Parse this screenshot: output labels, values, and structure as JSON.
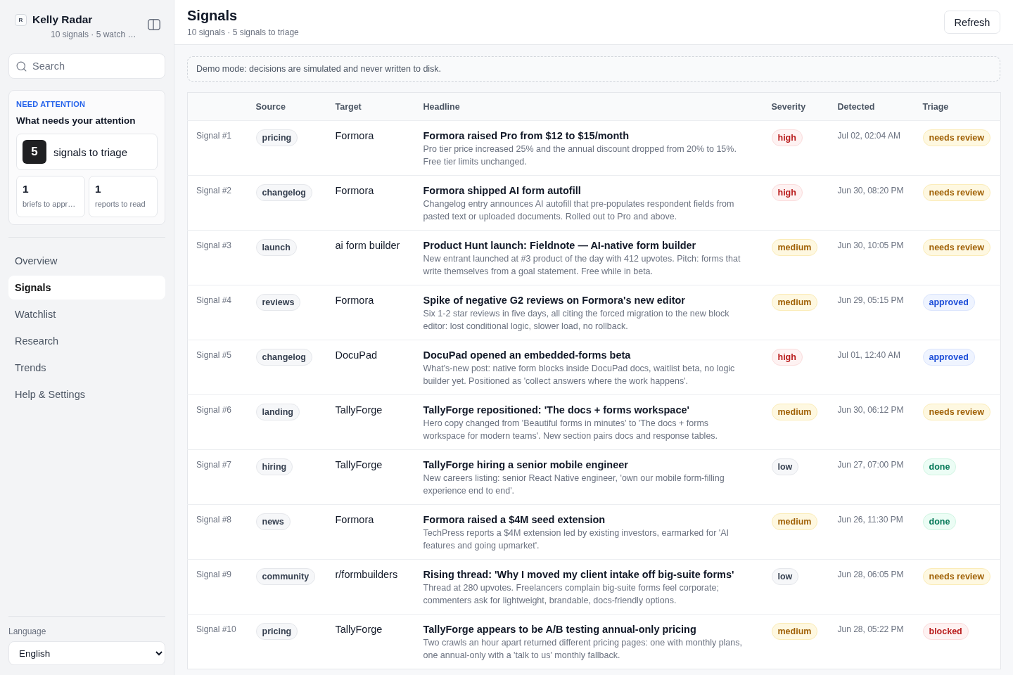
{
  "sidebar": {
    "app": {
      "logo": "R",
      "name": "Kelly Radar",
      "subtitle": "10 signals · 5 watch …"
    },
    "search": {
      "placeholder": "Search"
    },
    "attention": {
      "eyebrow": "NEED ATTENTION",
      "title": "What needs your attention",
      "primary": {
        "count": "5",
        "label": "signals to triage"
      },
      "secondary": [
        {
          "count": "1",
          "label": "briefs to appr…"
        },
        {
          "count": "1",
          "label": "reports to read"
        }
      ]
    },
    "nav": [
      {
        "label": "Overview",
        "selected": false
      },
      {
        "label": "Signals",
        "selected": true
      },
      {
        "label": "Watchlist",
        "selected": false
      },
      {
        "label": "Research",
        "selected": false
      },
      {
        "label": "Trends",
        "selected": false
      },
      {
        "label": "Help & Settings",
        "selected": false
      }
    ],
    "language": {
      "label": "Language",
      "value": "English"
    }
  },
  "header": {
    "title": "Signals",
    "subtitle": "10 signals · 5 signals to triage",
    "button": "Refresh"
  },
  "notice": "Demo mode: decisions are simulated and never written to disk.",
  "table": {
    "columns": [
      "Source",
      "Target",
      "Headline",
      "Severity",
      "Detected",
      "Triage"
    ],
    "rows": [
      {
        "id": "Signal #1",
        "source": "pricing",
        "target": "Formora",
        "headline": "Formora raised Pro from $12 to $15/month",
        "summary": "Pro tier price increased 25% and the annual discount dropped from 20% to 15%. Free tier limits unchanged.",
        "severity": {
          "label": "high",
          "kind": "high"
        },
        "detected": "Jul 02, 02:04 AM",
        "triage": {
          "label": "needs review",
          "kind": "review"
        }
      },
      {
        "id": "Signal #2",
        "source": "changelog",
        "target": "Formora",
        "headline": "Formora shipped AI form autofill",
        "summary": "Changelog entry announces AI autofill that pre-populates respondent fields from pasted text or uploaded documents. Rolled out to Pro and above.",
        "severity": {
          "label": "high",
          "kind": "high"
        },
        "detected": "Jun 30, 08:20 PM",
        "triage": {
          "label": "needs review",
          "kind": "review"
        }
      },
      {
        "id": "Signal #3",
        "source": "launch",
        "target": "ai form builder",
        "headline": "Product Hunt launch: Fieldnote — AI-native form builder",
        "summary": "New entrant launched at #3 product of the day with 412 upvotes. Pitch: forms that write themselves from a goal statement. Free while in beta.",
        "severity": {
          "label": "medium",
          "kind": "medium"
        },
        "detected": "Jun 30, 10:05 PM",
        "triage": {
          "label": "needs review",
          "kind": "review"
        }
      },
      {
        "id": "Signal #4",
        "source": "reviews",
        "target": "Formora",
        "headline": "Spike of negative G2 reviews on Formora's new editor",
        "summary": "Six 1-2 star reviews in five days, all citing the forced migration to the new block editor: lost conditional logic, slower load, no rollback.",
        "severity": {
          "label": "medium",
          "kind": "medium"
        },
        "detected": "Jun 29, 05:15 PM",
        "triage": {
          "label": "approved",
          "kind": "approved"
        }
      },
      {
        "id": "Signal #5",
        "source": "changelog",
        "target": "DocuPad",
        "headline": "DocuPad opened an embedded-forms beta",
        "summary": "What's-new post: native form blocks inside DocuPad docs, waitlist beta, no logic builder yet. Positioned as 'collect answers where the work happens'.",
        "severity": {
          "label": "high",
          "kind": "high"
        },
        "detected": "Jul 01, 12:40 AM",
        "triage": {
          "label": "approved",
          "kind": "approved"
        }
      },
      {
        "id": "Signal #6",
        "source": "landing",
        "target": "TallyForge",
        "headline": "TallyForge repositioned: 'The docs + forms workspace'",
        "summary": "Hero copy changed from 'Beautiful forms in minutes' to 'The docs + forms workspace for modern teams'. New section pairs docs and response tables.",
        "severity": {
          "label": "medium",
          "kind": "medium"
        },
        "detected": "Jun 30, 06:12 PM",
        "triage": {
          "label": "needs review",
          "kind": "review"
        }
      },
      {
        "id": "Signal #7",
        "source": "hiring",
        "target": "TallyForge",
        "headline": "TallyForge hiring a senior mobile engineer",
        "summary": "New careers listing: senior React Native engineer, 'own our mobile form-filling experience end to end'.",
        "severity": {
          "label": "low",
          "kind": "low"
        },
        "detected": "Jun 27, 07:00 PM",
        "triage": {
          "label": "done",
          "kind": "done"
        }
      },
      {
        "id": "Signal #8",
        "source": "news",
        "target": "Formora",
        "headline": "Formora raised a $4M seed extension",
        "summary": "TechPress reports a $4M extension led by existing investors, earmarked for 'AI features and going upmarket'.",
        "severity": {
          "label": "medium",
          "kind": "medium"
        },
        "detected": "Jun 26, 11:30 PM",
        "triage": {
          "label": "done",
          "kind": "done"
        }
      },
      {
        "id": "Signal #9",
        "source": "community",
        "target": "r/formbuilders",
        "headline": "Rising thread: 'Why I moved my client intake off big-suite forms'",
        "summary": "Thread at 280 upvotes. Freelancers complain big-suite forms feel corporate; commenters ask for lightweight, brandable, docs-friendly options.",
        "severity": {
          "label": "low",
          "kind": "low"
        },
        "detected": "Jun 28, 06:05 PM",
        "triage": {
          "label": "needs review",
          "kind": "review"
        }
      },
      {
        "id": "Signal #10",
        "source": "pricing",
        "target": "TallyForge",
        "headline": "TallyForge appears to be A/B testing annual-only pricing",
        "summary": "Two crawls an hour apart returned different pricing pages: one with monthly plans, one annual-only with a 'talk to us' monthly fallback.",
        "severity": {
          "label": "medium",
          "kind": "medium"
        },
        "detected": "Jun 28, 05:22 PM",
        "triage": {
          "label": "blocked",
          "kind": "blocked"
        }
      }
    ]
  }
}
